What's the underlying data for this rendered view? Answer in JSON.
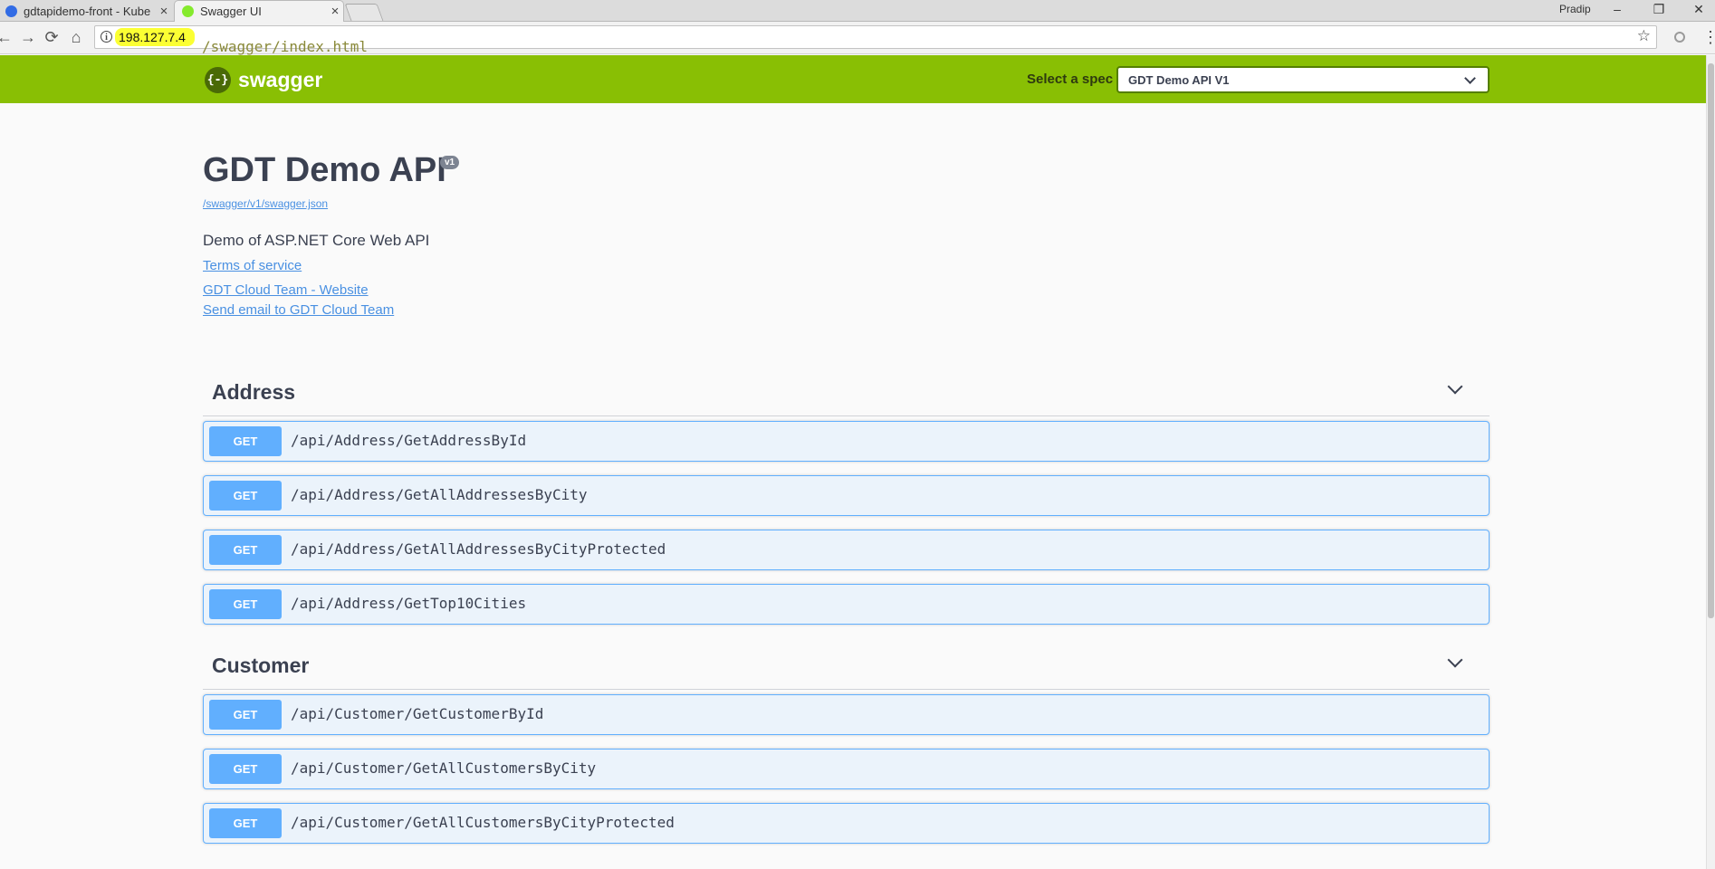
{
  "browser": {
    "tabs": [
      {
        "title": "gdtapidemo-front - Kube",
        "favicon_color": "#326ce5"
      },
      {
        "title": "Swagger UI",
        "favicon_color": "#85ea2d"
      }
    ],
    "user": "Pradip",
    "window_buttons": {
      "minimize": "–",
      "restore": "❐",
      "close": "✕"
    },
    "nav": {
      "back": "←",
      "forward": "→",
      "reload": "⟳",
      "home": "⌂"
    },
    "url_host": "198.127.7.4",
    "url_path": "/swagger/index.html",
    "info_icon": "i",
    "star": "☆",
    "menu": "⋮"
  },
  "topbar": {
    "logo_icon": "{-}",
    "logo_text": "swagger",
    "spec_label": "Select a spec",
    "spec_value": "GDT Demo API V1"
  },
  "info": {
    "title": "GDT Demo API",
    "version": "v1",
    "spec_url": "/swagger/v1/swagger.json",
    "description": "Demo of ASP.NET Core Web API",
    "terms": "Terms of service",
    "website": "GDT Cloud Team - Website",
    "email": "Send email to GDT Cloud Team"
  },
  "tags": [
    {
      "name": "Address",
      "operations": [
        {
          "method": "GET",
          "path": "/api/Address/GetAddressById"
        },
        {
          "method": "GET",
          "path": "/api/Address/GetAllAddressesByCity"
        },
        {
          "method": "GET",
          "path": "/api/Address/GetAllAddressesByCityProtected"
        },
        {
          "method": "GET",
          "path": "/api/Address/GetTop10Cities"
        }
      ]
    },
    {
      "name": "Customer",
      "operations": [
        {
          "method": "GET",
          "path": "/api/Customer/GetCustomerById"
        },
        {
          "method": "GET",
          "path": "/api/Customer/GetAllCustomersByCity"
        },
        {
          "method": "GET",
          "path": "/api/Customer/GetAllCustomersByCityProtected"
        }
      ]
    }
  ],
  "colors": {
    "topbar": "#89bf04",
    "get": "#61affe",
    "get_bg": "#ebf3fb",
    "link": "#4990e2",
    "url_highlight": "#fbff33"
  }
}
